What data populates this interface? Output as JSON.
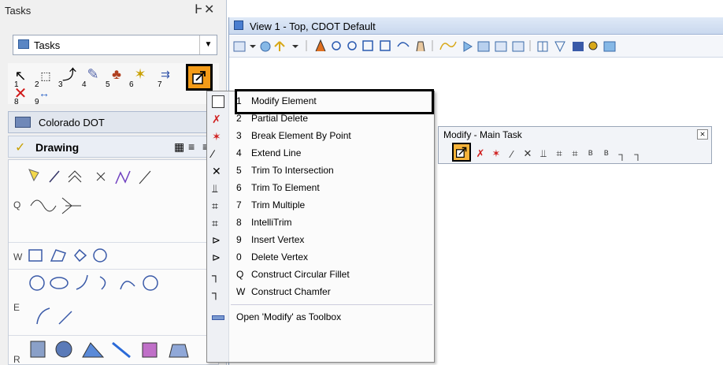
{
  "tasks_panel": {
    "title": "Tasks",
    "pin_close": "\u0000",
    "dropdown_label": "Tasks",
    "toolbox_numbers": [
      "1",
      "2",
      "3",
      "4",
      "5",
      "6",
      "7",
      "8",
      "9"
    ],
    "colorado_label": "Colorado DOT",
    "drawing_label": "Drawing",
    "row_keys": [
      "Q",
      "W",
      "E",
      "R"
    ]
  },
  "view": {
    "title": "View 1 - Top, CDOT Default"
  },
  "menu": {
    "items": [
      {
        "key": "1",
        "label": "Modify Element",
        "icon": "modify-element-icon"
      },
      {
        "key": "2",
        "label": "Partial Delete",
        "icon": "partial-delete-icon"
      },
      {
        "key": "3",
        "label": "Break Element By Point",
        "icon": "break-element-icon"
      },
      {
        "key": "4",
        "label": "Extend Line",
        "icon": "extend-line-icon"
      },
      {
        "key": "5",
        "label": "Trim To Intersection",
        "icon": "trim-intersection-icon"
      },
      {
        "key": "6",
        "label": "Trim To Element",
        "icon": "trim-element-icon"
      },
      {
        "key": "7",
        "label": "Trim Multiple",
        "icon": "trim-multiple-icon"
      },
      {
        "key": "8",
        "label": "IntelliTrim",
        "icon": "intellitrim-icon"
      },
      {
        "key": "9",
        "label": "Insert Vertex",
        "icon": "insert-vertex-icon"
      },
      {
        "key": "0",
        "label": "Delete Vertex",
        "icon": "delete-vertex-icon"
      },
      {
        "key": "Q",
        "label": "Construct Circular Fillet",
        "icon": "circular-fillet-icon"
      },
      {
        "key": "W",
        "label": "Construct Chamfer",
        "icon": "chamfer-icon"
      }
    ],
    "footer_label": "Open 'Modify' as Toolbox"
  },
  "modify_box": {
    "title": "Modify - Main Task",
    "close": "⨯"
  },
  "colors": {
    "highlight_orange": "#f39b18",
    "panel_bg": "#f0f0f0",
    "title_blue": "#c9d8ee"
  }
}
